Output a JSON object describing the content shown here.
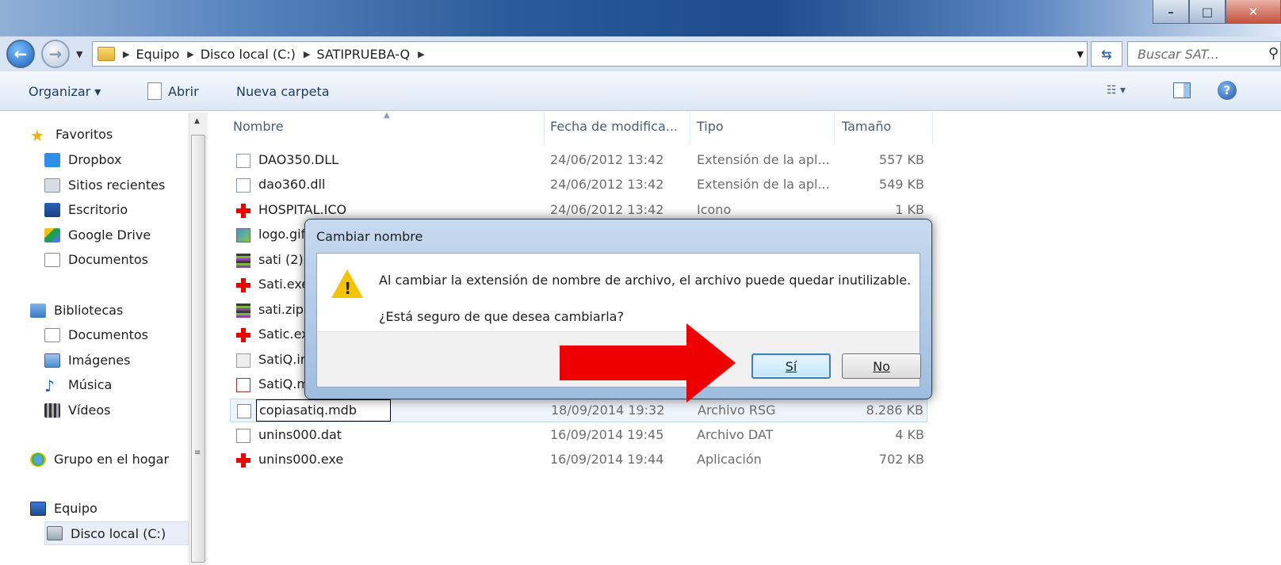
{
  "window": {
    "title": ""
  },
  "address": {
    "crumbs": [
      "Equipo",
      "Disco local (C:)",
      "SATIPRUEBA-Q"
    ],
    "search_placeholder": "Buscar SAT..."
  },
  "toolbar": {
    "organize": "Organizar ▾",
    "open": "Abrir",
    "new_folder": "Nueva carpeta"
  },
  "nav": {
    "favorites_header": "Favoritos",
    "favorites": [
      "Dropbox",
      "Sitios recientes",
      "Escritorio",
      "Google Drive",
      "Documentos"
    ],
    "libraries_header": "Bibliotecas",
    "libraries": [
      "Documentos",
      "Imágenes",
      "Música",
      "Vídeos"
    ],
    "homegroup": "Grupo en el hogar",
    "computer": "Equipo",
    "local_disk": "Disco local (C:)"
  },
  "columns": {
    "name": "Nombre",
    "date": "Fecha de modifica...",
    "type": "Tipo",
    "size": "Tamaño"
  },
  "files": [
    {
      "name": "DAO350.DLL",
      "date": "24/06/2012 13:42",
      "type": "Extensión de la apl...",
      "size": "557 KB",
      "icon": "dll-icon"
    },
    {
      "name": "dao360.dll",
      "date": "24/06/2012 13:42",
      "type": "Extensión de la apl...",
      "size": "549 KB",
      "icon": "dll-icon"
    },
    {
      "name": "HOSPITAL.ICO",
      "date": "24/06/2012 13:42",
      "type": "Icono",
      "size": "1 KB",
      "icon": "red-cross-icon"
    },
    {
      "name": "logo.gif",
      "date": "",
      "type": "",
      "size": "",
      "icon": "image-icon"
    },
    {
      "name": "sati (2).",
      "date": "",
      "type": "",
      "size": "",
      "icon": "archive-icon"
    },
    {
      "name": "Sati.exe",
      "date": "",
      "type": "",
      "size": "",
      "icon": "red-cross-icon"
    },
    {
      "name": "sati.zip",
      "date": "",
      "type": "",
      "size": "",
      "icon": "archive-icon"
    },
    {
      "name": "Satic.ex",
      "date": "",
      "type": "",
      "size": "",
      "icon": "red-cross-icon"
    },
    {
      "name": "SatiQ.ir",
      "date": "",
      "type": "",
      "size": "",
      "icon": "settings-file-icon"
    },
    {
      "name": "SatiQ.m",
      "date": "",
      "type": "",
      "size": "",
      "icon": "database-icon"
    },
    {
      "name": "copiasatiq.mdb",
      "date": "18/09/2014 19:32",
      "type": "Archivo RSG",
      "size": "8.286 KB",
      "icon": "blank-file-icon"
    },
    {
      "name": "unins000.dat",
      "date": "16/09/2014 19:45",
      "type": "Archivo DAT",
      "size": "4 KB",
      "icon": "blank-file-icon"
    },
    {
      "name": "unins000.exe",
      "date": "16/09/2014 19:44",
      "type": "Aplicación",
      "size": "702 KB",
      "icon": "red-cross-icon"
    }
  ],
  "dialog": {
    "title": "Cambiar nombre",
    "message": "Al cambiar la extensión de nombre de archivo, el archivo puede quedar inutilizable.",
    "question": "¿Está seguro de que desea cambiarla?",
    "yes": "Sí",
    "no": "No"
  },
  "colors": {
    "annotation_arrow": "#ee0000",
    "warning": "#f5c400"
  }
}
